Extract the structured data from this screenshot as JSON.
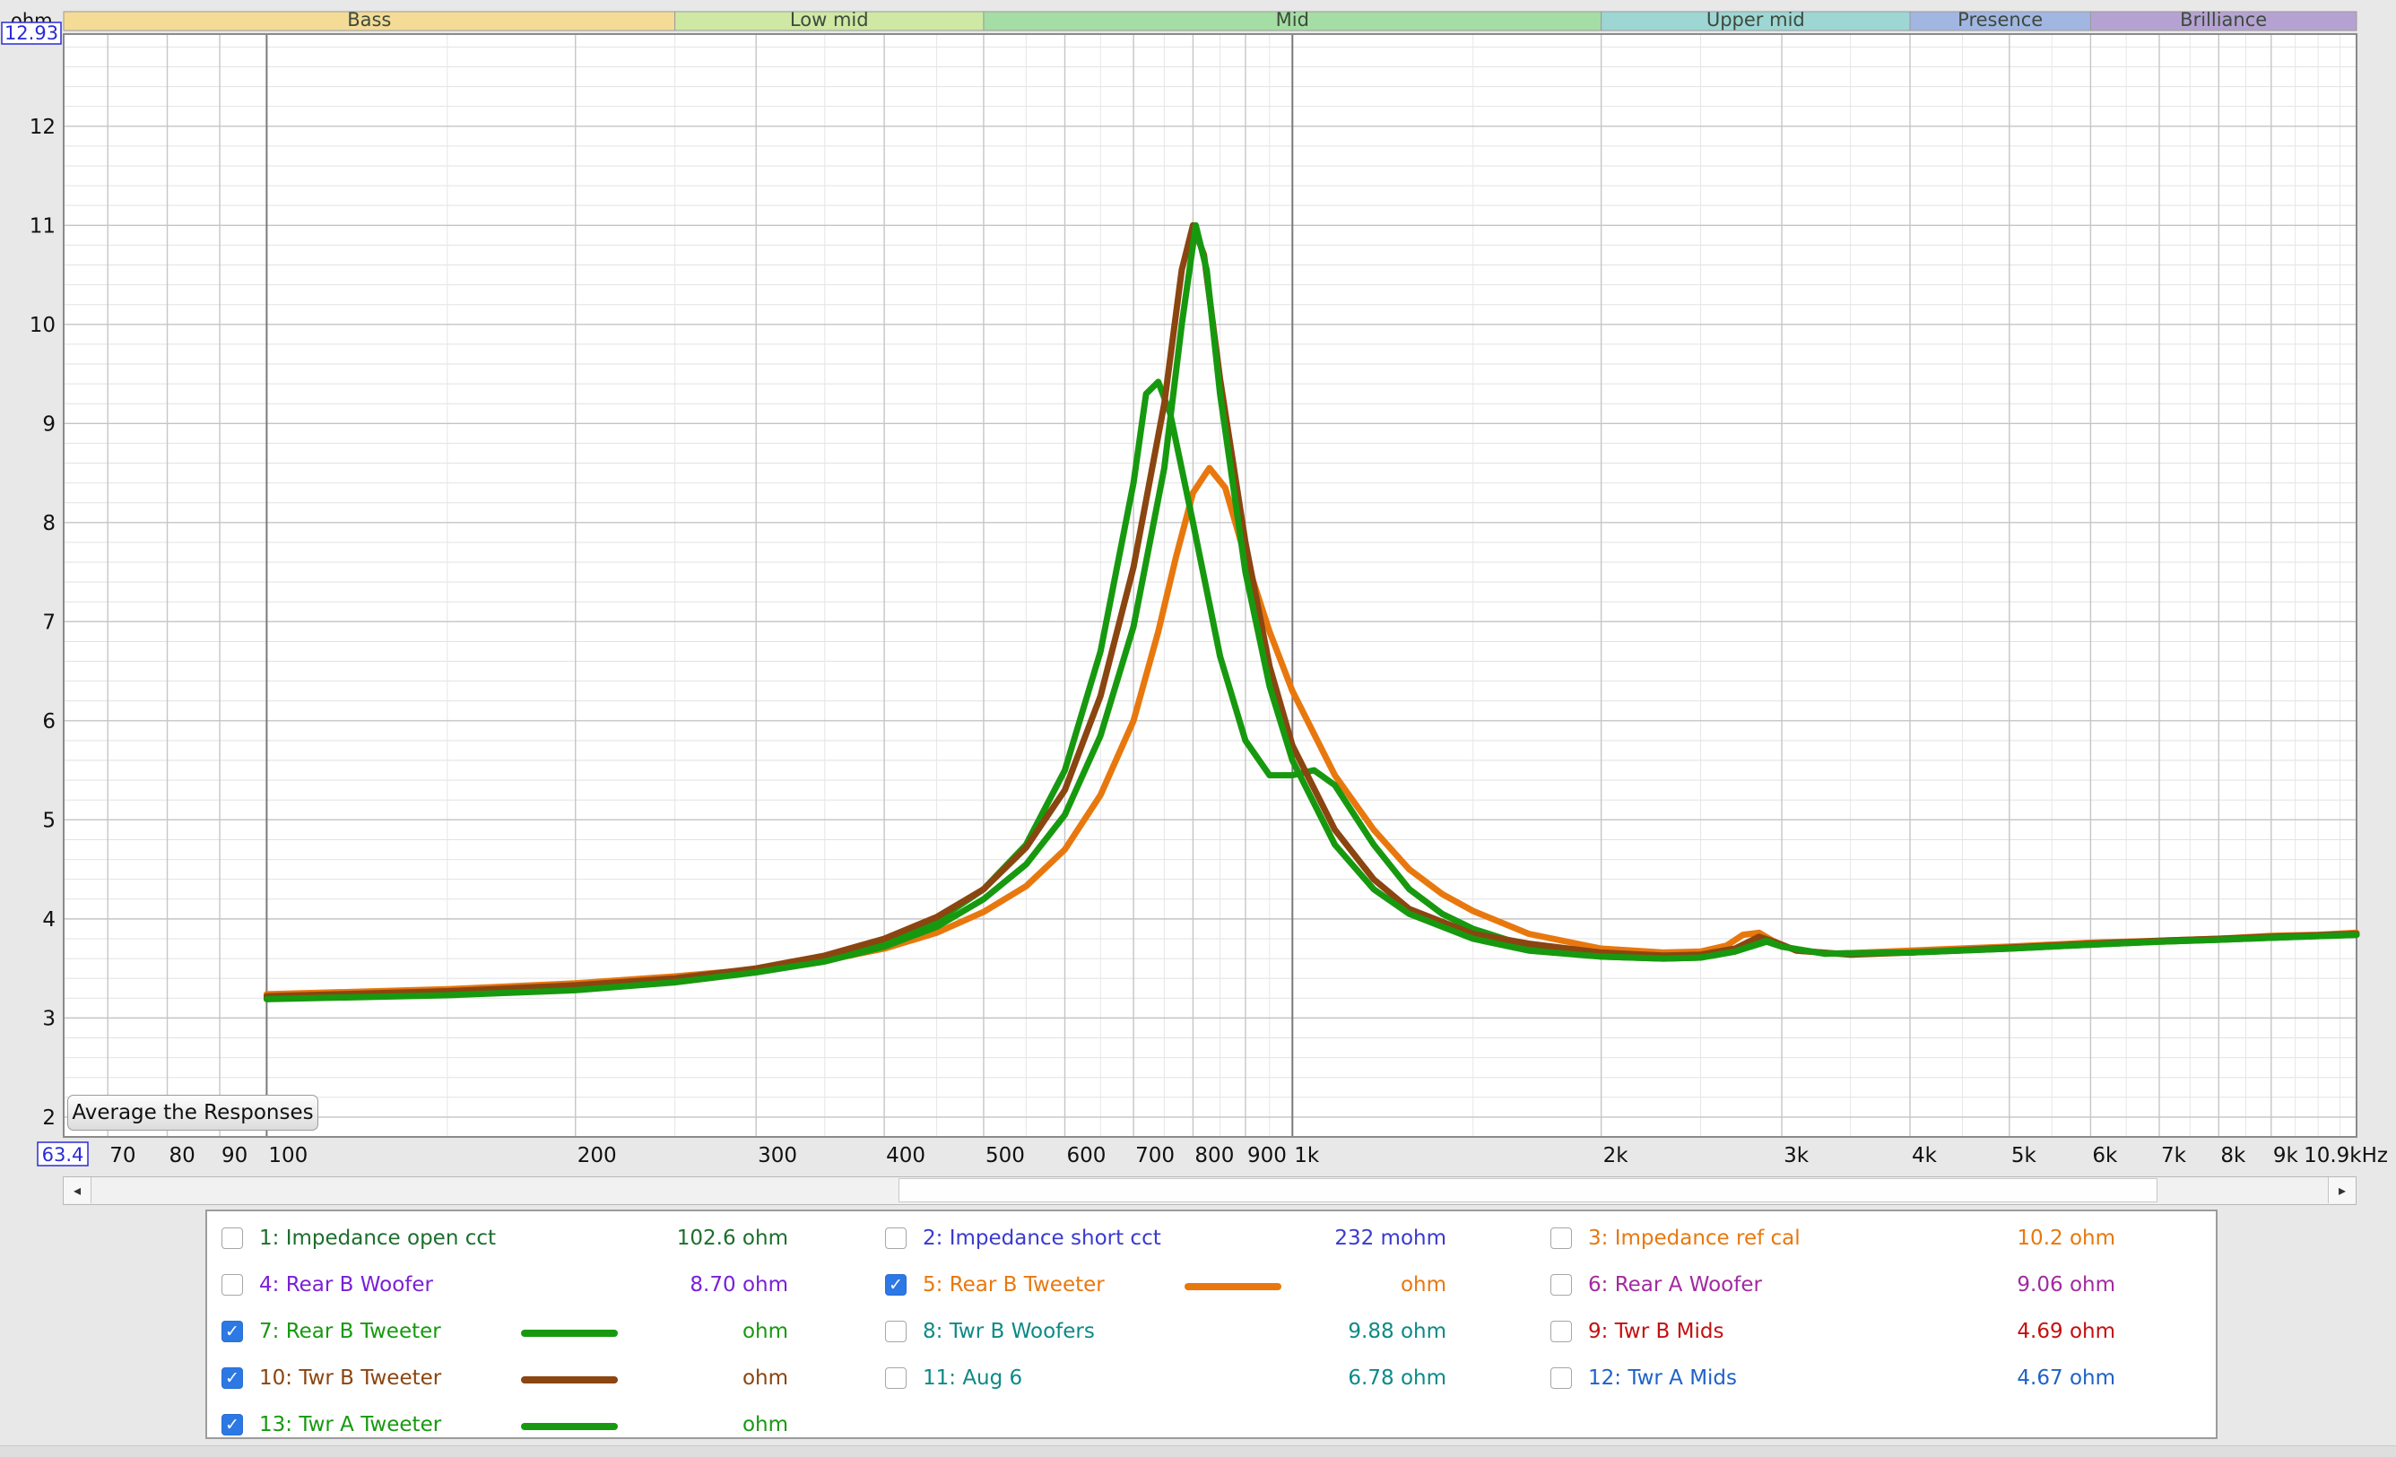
{
  "chart_data": {
    "type": "line",
    "ylabel": "ohm",
    "y_top_readout": "12.93",
    "x_left_readout": "63.4",
    "xscale": "log",
    "xlim": [
      63.4,
      10900
    ],
    "ylim": [
      1.8,
      12.93
    ],
    "grid": true,
    "x_ticks": [
      {
        "v": 70,
        "label": "70"
      },
      {
        "v": 80,
        "label": "80"
      },
      {
        "v": 90,
        "label": "90"
      },
      {
        "v": 100,
        "label": "100"
      },
      {
        "v": 200,
        "label": "200"
      },
      {
        "v": 300,
        "label": "300"
      },
      {
        "v": 400,
        "label": "400"
      },
      {
        "v": 500,
        "label": "500"
      },
      {
        "v": 600,
        "label": "600"
      },
      {
        "v": 700,
        "label": "700"
      },
      {
        "v": 800,
        "label": "800"
      },
      {
        "v": 900,
        "label": "900"
      },
      {
        "v": 1000,
        "label": "1k"
      },
      {
        "v": 2000,
        "label": "2k"
      },
      {
        "v": 3000,
        "label": "3k"
      },
      {
        "v": 4000,
        "label": "4k"
      },
      {
        "v": 5000,
        "label": "5k"
      },
      {
        "v": 6000,
        "label": "6k"
      },
      {
        "v": 7000,
        "label": "7k"
      },
      {
        "v": 8000,
        "label": "8k"
      },
      {
        "v": 9000,
        "label": "9k"
      },
      {
        "v": 10900,
        "label": "10.9kHz"
      }
    ],
    "y_ticks": [
      2,
      3,
      4,
      5,
      6,
      7,
      8,
      9,
      10,
      11,
      12
    ],
    "bands": [
      {
        "label": "Bass",
        "from": 63.4,
        "to": 250,
        "color": "#f4dc96"
      },
      {
        "label": "Low mid",
        "from": 250,
        "to": 500,
        "color": "#cfe8a4"
      },
      {
        "label": "Mid",
        "from": 500,
        "to": 2000,
        "color": "#a4dea4"
      },
      {
        "label": "Upper mid",
        "from": 2000,
        "to": 4000,
        "color": "#9ed6d4"
      },
      {
        "label": "Presence",
        "from": 4000,
        "to": 6000,
        "color": "#a2b6e2"
      },
      {
        "label": "Brilliance",
        "from": 6000,
        "to": 10900,
        "color": "#b6a2d2"
      }
    ],
    "series": [
      {
        "name": "5: Rear B Tweeter",
        "color": "#e8780e",
        "points": [
          [
            100,
            3.24
          ],
          [
            150,
            3.29
          ],
          [
            200,
            3.35
          ],
          [
            250,
            3.42
          ],
          [
            300,
            3.49
          ],
          [
            350,
            3.58
          ],
          [
            400,
            3.7
          ],
          [
            450,
            3.86
          ],
          [
            500,
            4.07
          ],
          [
            550,
            4.33
          ],
          [
            600,
            4.7
          ],
          [
            650,
            5.25
          ],
          [
            700,
            6.0
          ],
          [
            740,
            6.9
          ],
          [
            770,
            7.65
          ],
          [
            800,
            8.3
          ],
          [
            830,
            8.55
          ],
          [
            860,
            8.35
          ],
          [
            900,
            7.65
          ],
          [
            950,
            6.9
          ],
          [
            1000,
            6.3
          ],
          [
            1100,
            5.45
          ],
          [
            1200,
            4.9
          ],
          [
            1300,
            4.5
          ],
          [
            1400,
            4.25
          ],
          [
            1500,
            4.08
          ],
          [
            1700,
            3.85
          ],
          [
            2000,
            3.7
          ],
          [
            2300,
            3.66
          ],
          [
            2500,
            3.67
          ],
          [
            2650,
            3.73
          ],
          [
            2750,
            3.84
          ],
          [
            2850,
            3.86
          ],
          [
            2950,
            3.77
          ],
          [
            3100,
            3.68
          ],
          [
            3400,
            3.65
          ],
          [
            4000,
            3.68
          ],
          [
            5000,
            3.72
          ],
          [
            6000,
            3.76
          ],
          [
            7000,
            3.78
          ],
          [
            8000,
            3.8
          ],
          [
            9000,
            3.83
          ],
          [
            10000,
            3.84
          ],
          [
            10900,
            3.86
          ]
        ]
      },
      {
        "name": "7: Rear B Tweeter",
        "color": "#17990f",
        "points": [
          [
            100,
            3.2
          ],
          [
            150,
            3.25
          ],
          [
            200,
            3.3
          ],
          [
            250,
            3.38
          ],
          [
            300,
            3.48
          ],
          [
            350,
            3.6
          ],
          [
            400,
            3.75
          ],
          [
            450,
            3.98
          ],
          [
            500,
            4.3
          ],
          [
            550,
            4.75
          ],
          [
            600,
            5.5
          ],
          [
            650,
            6.7
          ],
          [
            700,
            8.4
          ],
          [
            720,
            9.3
          ],
          [
            740,
            9.42
          ],
          [
            760,
            9.1
          ],
          [
            800,
            8.0
          ],
          [
            850,
            6.65
          ],
          [
            900,
            5.8
          ],
          [
            950,
            5.45
          ],
          [
            1000,
            5.45
          ],
          [
            1050,
            5.5
          ],
          [
            1100,
            5.35
          ],
          [
            1200,
            4.75
          ],
          [
            1300,
            4.3
          ],
          [
            1400,
            4.05
          ],
          [
            1500,
            3.9
          ],
          [
            1700,
            3.72
          ],
          [
            2000,
            3.62
          ],
          [
            2300,
            3.6
          ],
          [
            2500,
            3.61
          ],
          [
            2700,
            3.67
          ],
          [
            2900,
            3.77
          ],
          [
            3000,
            3.72
          ],
          [
            3300,
            3.65
          ],
          [
            4000,
            3.66
          ],
          [
            5000,
            3.7
          ],
          [
            6000,
            3.74
          ],
          [
            7000,
            3.77
          ],
          [
            8000,
            3.79
          ],
          [
            9000,
            3.81
          ],
          [
            10900,
            3.84
          ]
        ]
      },
      {
        "name": "10: Twr B Tweeter",
        "color": "#8b4510",
        "points": [
          [
            100,
            3.22
          ],
          [
            150,
            3.27
          ],
          [
            200,
            3.33
          ],
          [
            250,
            3.4
          ],
          [
            300,
            3.5
          ],
          [
            350,
            3.63
          ],
          [
            400,
            3.8
          ],
          [
            450,
            4.02
          ],
          [
            500,
            4.3
          ],
          [
            550,
            4.72
          ],
          [
            600,
            5.3
          ],
          [
            650,
            6.25
          ],
          [
            700,
            7.55
          ],
          [
            750,
            9.2
          ],
          [
            780,
            10.55
          ],
          [
            800,
            11.0
          ],
          [
            820,
            10.7
          ],
          [
            850,
            9.45
          ],
          [
            900,
            7.8
          ],
          [
            950,
            6.55
          ],
          [
            1000,
            5.75
          ],
          [
            1100,
            4.9
          ],
          [
            1200,
            4.4
          ],
          [
            1300,
            4.1
          ],
          [
            1500,
            3.85
          ],
          [
            1700,
            3.75
          ],
          [
            2000,
            3.66
          ],
          [
            2300,
            3.63
          ],
          [
            2500,
            3.64
          ],
          [
            2700,
            3.7
          ],
          [
            2850,
            3.82
          ],
          [
            2950,
            3.77
          ],
          [
            3100,
            3.68
          ],
          [
            3500,
            3.64
          ],
          [
            4000,
            3.66
          ],
          [
            5000,
            3.71
          ],
          [
            6000,
            3.75
          ],
          [
            7000,
            3.78
          ],
          [
            8000,
            3.8
          ],
          [
            9000,
            3.82
          ],
          [
            10900,
            3.85
          ]
        ]
      },
      {
        "name": "13: Twr A Tweeter",
        "color": "#17990f",
        "points": [
          [
            100,
            3.19
          ],
          [
            150,
            3.23
          ],
          [
            200,
            3.28
          ],
          [
            250,
            3.36
          ],
          [
            300,
            3.46
          ],
          [
            350,
            3.57
          ],
          [
            400,
            3.72
          ],
          [
            450,
            3.92
          ],
          [
            500,
            4.2
          ],
          [
            550,
            4.55
          ],
          [
            600,
            5.05
          ],
          [
            650,
            5.85
          ],
          [
            700,
            6.95
          ],
          [
            750,
            8.55
          ],
          [
            780,
            10.0
          ],
          [
            805,
            11.0
          ],
          [
            825,
            10.55
          ],
          [
            850,
            9.3
          ],
          [
            900,
            7.5
          ],
          [
            950,
            6.35
          ],
          [
            1000,
            5.6
          ],
          [
            1100,
            4.75
          ],
          [
            1200,
            4.3
          ],
          [
            1300,
            4.05
          ],
          [
            1500,
            3.8
          ],
          [
            1700,
            3.68
          ],
          [
            2000,
            3.62
          ],
          [
            2300,
            3.6
          ],
          [
            2500,
            3.61
          ],
          [
            2700,
            3.67
          ],
          [
            2900,
            3.78
          ],
          [
            3000,
            3.72
          ],
          [
            3300,
            3.65
          ],
          [
            4000,
            3.66
          ],
          [
            5000,
            3.7
          ],
          [
            6000,
            3.74
          ],
          [
            7000,
            3.77
          ],
          [
            8000,
            3.79
          ],
          [
            9000,
            3.81
          ],
          [
            10900,
            3.84
          ]
        ]
      }
    ]
  },
  "controls": {
    "average_button": "Average the Responses",
    "scroll_left": "◂",
    "scroll_right": "▸"
  },
  "legend": [
    {
      "label": "1: Impedance open cct",
      "value": "102.6 ohm",
      "checked": false,
      "color": "#1d6e2d"
    },
    {
      "label": "2: Impedance short cct",
      "value": "232 mohm",
      "checked": false,
      "color": "#3a3ad0"
    },
    {
      "label": "3: Impedance ref cal",
      "value": "10.2 ohm",
      "checked": false,
      "color": "#e8780e"
    },
    {
      "label": "4: Rear B Woofer",
      "value": "8.70 ohm",
      "checked": false,
      "color": "#7b1fd8"
    },
    {
      "label": "5: Rear B Tweeter",
      "value": "ohm",
      "checked": true,
      "color": "#e8780e"
    },
    {
      "label": "6: Rear A Woofer",
      "value": "9.06 ohm",
      "checked": false,
      "color": "#a22aa0"
    },
    {
      "label": "7: Rear B Tweeter",
      "value": "ohm",
      "checked": true,
      "color": "#17990f"
    },
    {
      "label": "8: Twr B Woofers",
      "value": "9.88 ohm",
      "checked": false,
      "color": "#0c8a86"
    },
    {
      "label": "9: Twr B Mids",
      "value": "4.69 ohm",
      "checked": false,
      "color": "#c41010"
    },
    {
      "label": "10: Twr B Tweeter",
      "value": "ohm",
      "checked": true,
      "color": "#8b4510"
    },
    {
      "label": "11: Aug 6",
      "value": "6.78 ohm",
      "checked": false,
      "color": "#0c8a86"
    },
    {
      "label": "12: Twr A Mids",
      "value": "4.67 ohm",
      "checked": false,
      "color": "#1f62c8"
    },
    {
      "label": "13: Twr A Tweeter",
      "value": "ohm",
      "checked": true,
      "color": "#17990f"
    }
  ]
}
